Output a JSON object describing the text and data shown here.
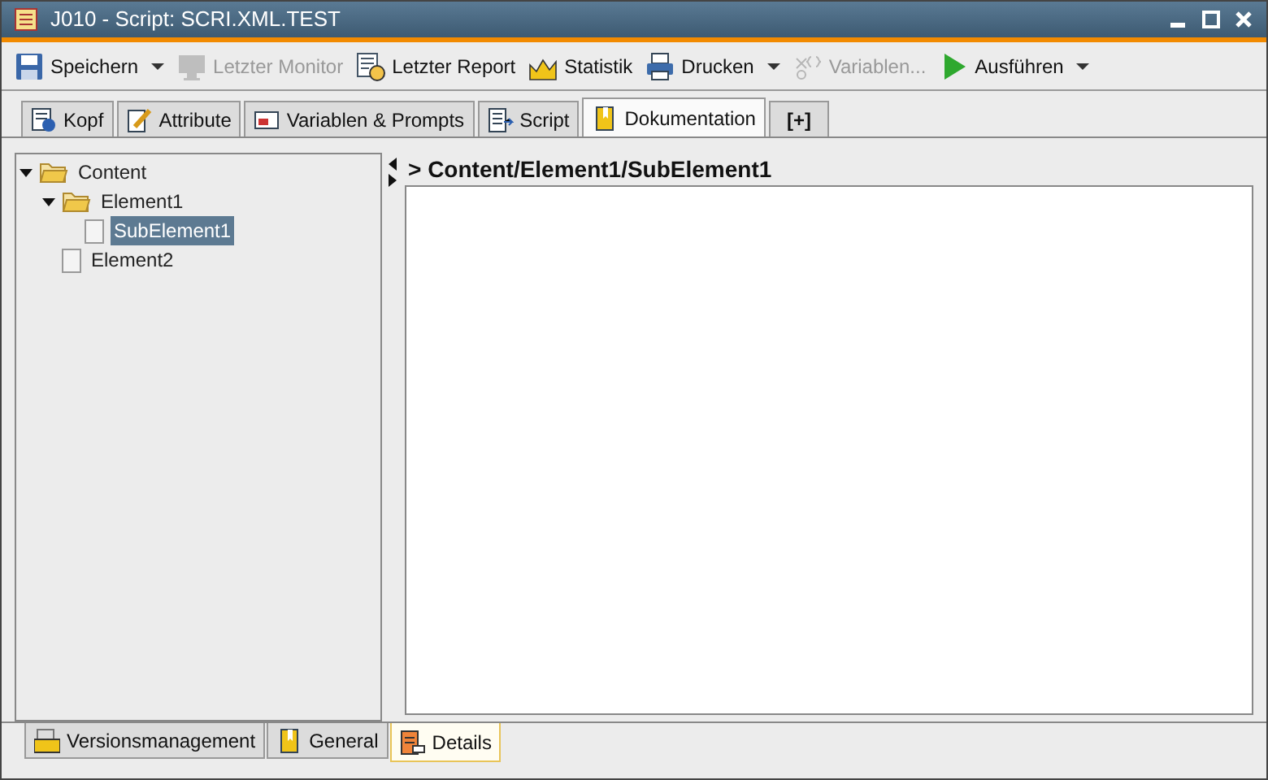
{
  "window": {
    "title": "J010 - Script: SCRI.XML.TEST"
  },
  "toolbar": [
    {
      "kind": "save",
      "label": "Speichern",
      "disabled": false,
      "dropdown": true
    },
    {
      "kind": "monitor",
      "label": "Letzter Monitor",
      "disabled": true,
      "dropdown": false
    },
    {
      "kind": "report",
      "label": "Letzter Report",
      "disabled": false,
      "dropdown": false
    },
    {
      "kind": "chart",
      "label": "Statistik",
      "disabled": false,
      "dropdown": false
    },
    {
      "kind": "print",
      "label": "Drucken",
      "disabled": false,
      "dropdown": true
    },
    {
      "kind": "variables",
      "label": "Variablen...",
      "disabled": true,
      "dropdown": false
    },
    {
      "kind": "run",
      "label": "Ausführen",
      "disabled": false,
      "dropdown": true
    }
  ],
  "tabs": [
    {
      "kind": "info",
      "label": "Kopf",
      "selected": false
    },
    {
      "kind": "pencil",
      "label": "Attribute",
      "selected": false
    },
    {
      "kind": "variables",
      "label": "Variablen & Prompts",
      "selected": false
    },
    {
      "kind": "script",
      "label": "Script",
      "selected": false
    },
    {
      "kind": "book",
      "label": "Dokumentation",
      "selected": true
    },
    {
      "kind": "add",
      "label": "[+]",
      "selected": false
    }
  ],
  "tree": [
    {
      "label": "Content",
      "kind": "folder",
      "expanded": true,
      "selected": false,
      "children": [
        {
          "label": "Element1",
          "kind": "folder",
          "expanded": true,
          "selected": false,
          "children": [
            {
              "label": "SubElement1",
              "kind": "page",
              "selected": true
            }
          ]
        },
        {
          "label": "Element2",
          "kind": "page",
          "selected": false
        }
      ]
    }
  ],
  "editor": {
    "path": "> Content/Element1/SubElement1"
  },
  "bottom_tabs": [
    {
      "kind": "ucs",
      "label": "Versionsmanagement",
      "selected": false
    },
    {
      "kind": "book",
      "label": "General",
      "selected": false
    },
    {
      "kind": "details",
      "label": "Details",
      "selected": true
    }
  ]
}
